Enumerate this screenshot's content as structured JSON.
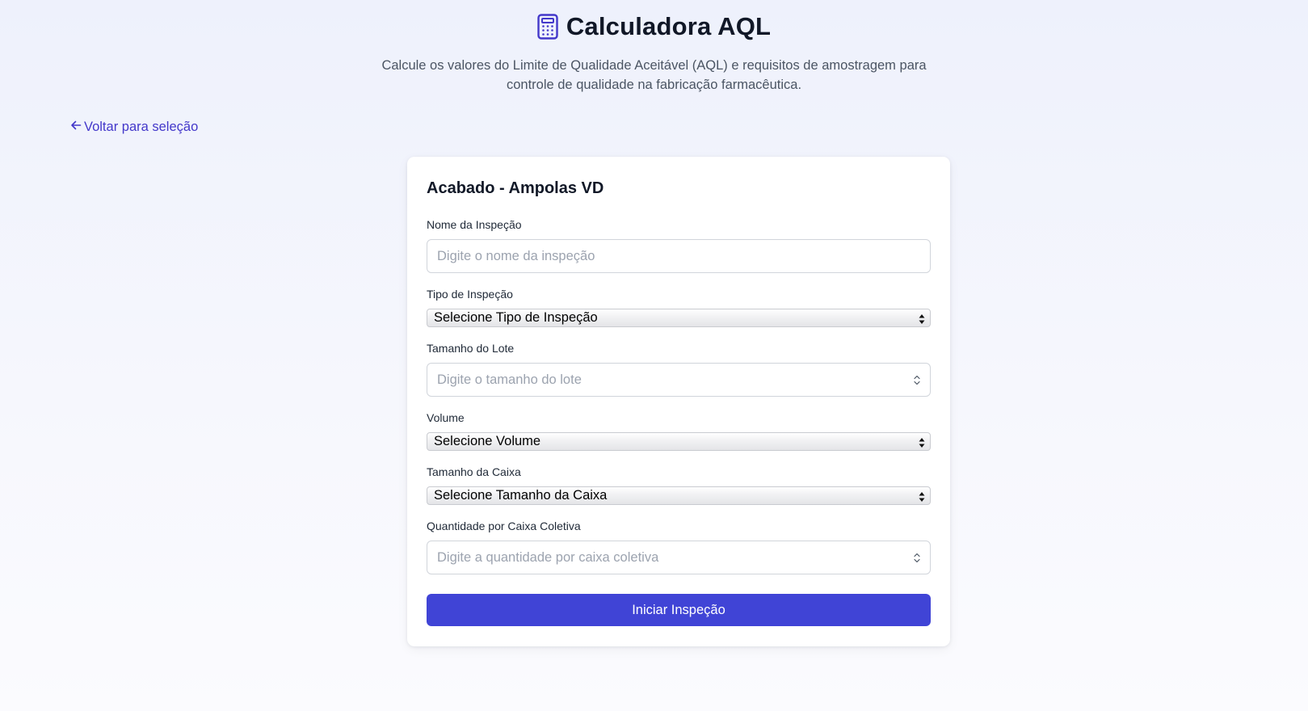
{
  "header": {
    "title": "Calculadora AQL",
    "subtitle": "Calcule os valores do Limite de Qualidade Aceitável (AQL) e requisitos de amostragem para controle de qualidade na fabricação farmacêutica.",
    "icon": "calculator-icon",
    "accent_color": "#4338ca"
  },
  "nav": {
    "back_label": "Voltar para seleção",
    "back_icon": "arrow-left-icon"
  },
  "form": {
    "title": "Acabado - Ampolas VD",
    "inspection_name": {
      "label": "Nome da Inspeção",
      "placeholder": "Digite o nome da inspeção",
      "value": ""
    },
    "inspection_type": {
      "label": "Tipo de Inspeção",
      "selected": "Selecione Tipo de Inspeção"
    },
    "lot_size": {
      "label": "Tamanho do Lote",
      "placeholder": "Digite o tamanho do lote",
      "value": ""
    },
    "volume": {
      "label": "Volume",
      "selected": "Selecione Volume"
    },
    "box_size": {
      "label": "Tamanho da Caixa",
      "selected": "Selecione Tamanho da Caixa"
    },
    "qty_per_box": {
      "label": "Quantidade por Caixa Coletiva",
      "placeholder": "Digite a quantidade por caixa coletiva",
      "value": ""
    },
    "submit_label": "Iniciar Inspeção",
    "button_color": "#4044d6"
  }
}
